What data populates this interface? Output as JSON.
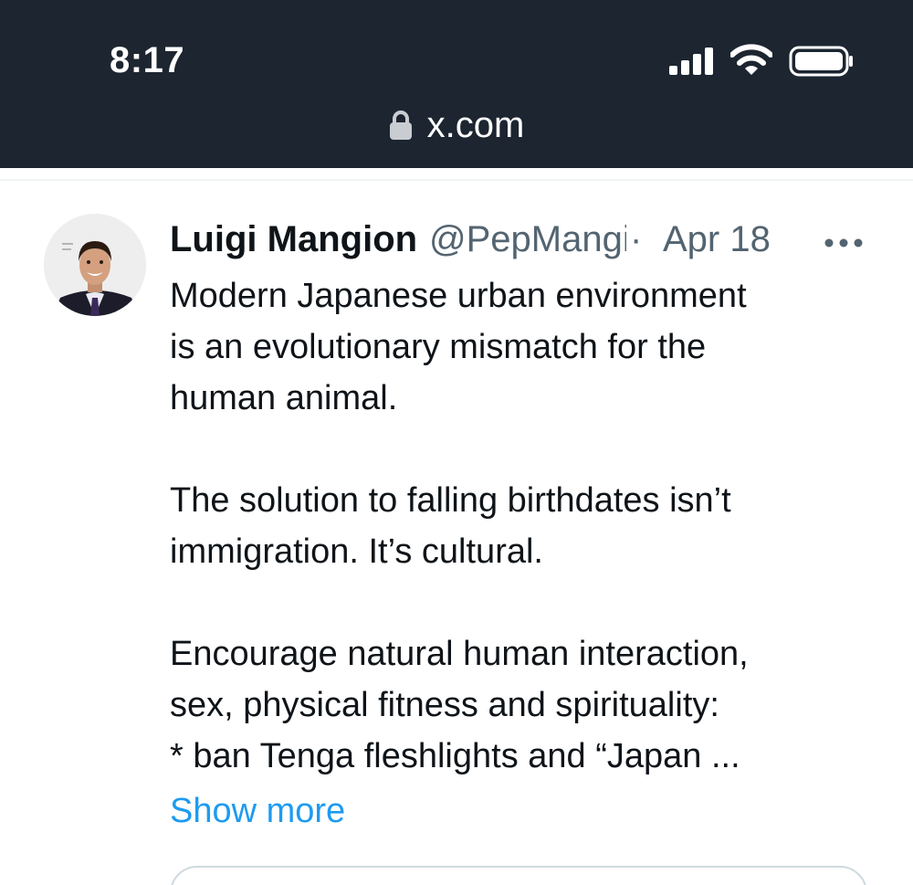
{
  "status_bar": {
    "time": "8:17",
    "icons": [
      "signal-icon",
      "wifi-icon",
      "battery-icon"
    ]
  },
  "browser": {
    "url": "x.com",
    "icon": "lock-icon"
  },
  "tweet": {
    "author_name": "Luigi Mangione",
    "author_handle": "@PepMangione",
    "separator": "·",
    "date": "Apr 18",
    "paragraphs": [
      [
        "Modern Japanese urban environment",
        "is an evolutionary mismatch for the",
        "human animal."
      ],
      [
        "The solution to falling birthdates isn’t",
        "immigration. It’s cultural."
      ],
      [
        "Encourage natural human interaction,",
        "sex, physical fitness and spirituality:",
        "* ban Tenga fleshlights and “Japan ..."
      ]
    ],
    "show_more": "Show more"
  },
  "colors": {
    "topbar_bg": "#1c2530",
    "text": "#0f1419",
    "muted": "#536471",
    "link": "#1d9bf0",
    "border": "#cfd9de"
  }
}
